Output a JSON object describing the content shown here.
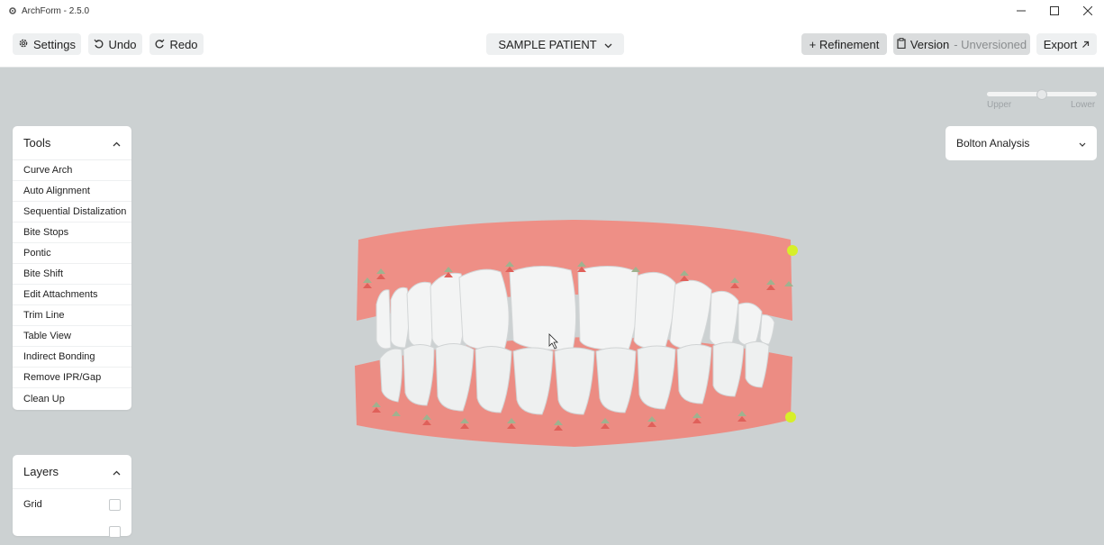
{
  "window": {
    "title": "ArchForm - 2.5.0",
    "icons": {
      "app": "gear-icon",
      "minimize": "minimize-icon",
      "maximize": "maximize-icon",
      "close": "close-icon"
    }
  },
  "toolbar": {
    "settings_label": "Settings",
    "undo_label": "Undo",
    "redo_label": "Redo",
    "patient_label": "SAMPLE PATIENT",
    "refinement_label": "+ Refinement",
    "version_label": "Version",
    "version_status": "- Unversioned",
    "export_label": "Export"
  },
  "arch_slider": {
    "upper_label": "Upper",
    "lower_label": "Lower",
    "value": 0.5
  },
  "tools_panel": {
    "title": "Tools",
    "items": [
      "Curve Arch",
      "Auto Alignment",
      "Sequential Distalization",
      "Bite Stops",
      "Pontic",
      "Bite Shift",
      "Edit Attachments",
      "Trim Line",
      "Table View",
      "Indirect Bonding",
      "Remove IPR/Gap",
      "Clean Up"
    ]
  },
  "layers_panel": {
    "title": "Layers",
    "items": [
      {
        "label": "Grid",
        "checked": false
      }
    ]
  },
  "bolton": {
    "label": "Bolton Analysis"
  },
  "colors": {
    "viewport_bg": "#ccd1d2",
    "gum": "#ee8f86",
    "tooth": "#f4f5f5",
    "marker_green": "#9fb28f",
    "marker_red": "#e0605a",
    "handle_yellow": "#d7ef2a"
  }
}
